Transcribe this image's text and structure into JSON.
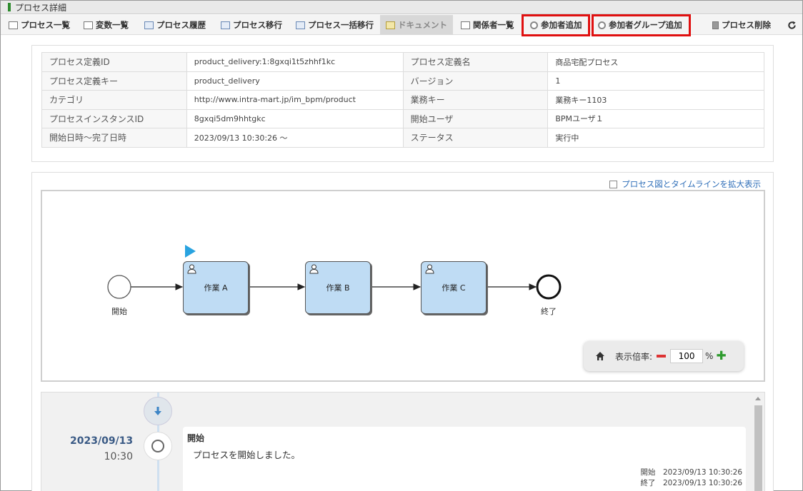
{
  "window": {
    "title": "プロセス詳細"
  },
  "toolbar": {
    "process_list": "プロセス一覧",
    "variables_list": "変数一覧",
    "process_history": "プロセス履歴",
    "process_migrate": "プロセス移行",
    "process_bulk_migrate": "プロセス一括移行",
    "document": "ドキュメント",
    "stakeholders_list": "関係者一覧",
    "add_participant": "参加者追加",
    "add_participant_group": "参加者グループ追加",
    "delete_process": "プロセス削除",
    "refresh_icon": "refresh-icon"
  },
  "info": {
    "rows": [
      {
        "k1": "プロセス定義ID",
        "v1": "product_delivery:1:8gxqi1t5zhhf1kc",
        "k2": "プロセス定義名",
        "v2": "商品宅配プロセス"
      },
      {
        "k1": "プロセス定義キー",
        "v1": "product_delivery",
        "k2": "バージョン",
        "v2": "1"
      },
      {
        "k1": "カテゴリ",
        "v1": "http://www.intra-mart.jp/im_bpm/product",
        "k2": "業務キー",
        "v2": "業務キー1103"
      },
      {
        "k1": "プロセスインスタンスID",
        "v1": "8gxqi5dm9hhtgkc",
        "k2": "開始ユーザ",
        "v2": "BPMユーザ１"
      },
      {
        "k1": "開始日時～完了日時",
        "v1": "2023/09/13 10:30:26 ～",
        "k2": "ステータス",
        "v2": "実行中"
      }
    ]
  },
  "diagram": {
    "expand_link": "プロセス図とタイムラインを拡大表示",
    "start_label": "開始",
    "end_label": "終了",
    "tasks": [
      "作業 A",
      "作業 B",
      "作業 C"
    ],
    "zoom_label": "表示倍率:",
    "zoom_value": "100",
    "zoom_unit": "%",
    "current_marker_color": "#29a3e0"
  },
  "timeline": {
    "date": "2023/09/13",
    "time": "10:30",
    "entry_title": "開始",
    "entry_message": "プロセスを開始しました。",
    "meta_start": "開始　2023/09/13 10:30:26",
    "meta_end": "終了　2023/09/13 10:30:26"
  },
  "colors": {
    "highlight": "#e01010",
    "task_fill": "#bfdcf4",
    "link": "#2e6eb8"
  }
}
